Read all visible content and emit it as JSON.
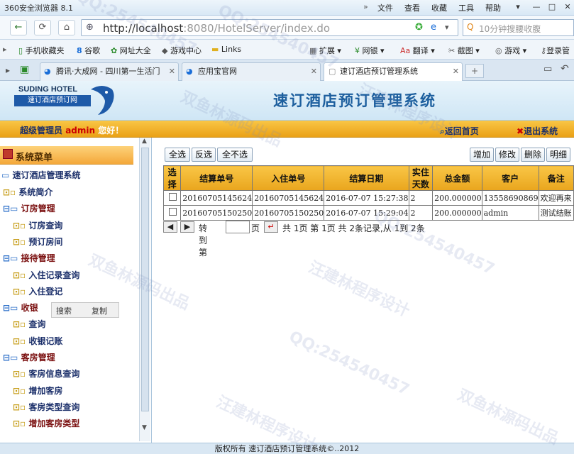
{
  "browser": {
    "title": "360安全浏览器 8.1",
    "menus": [
      "文件",
      "查看",
      "收藏",
      "工具",
      "帮助"
    ],
    "window_buttons": [
      "▾",
      "—",
      "□",
      "✕"
    ],
    "url_host": "http://localhost",
    "url_rest": ":8080/HotelServer/index.do",
    "search_placeholder": "10分钟搜腰收腹",
    "bookmarks": [
      "手机收藏夹",
      "谷歌",
      "网址大全",
      "游戏中心",
      "Links"
    ],
    "bookmarks_right": [
      "扩展",
      "网银",
      "翻译",
      "截图",
      "游戏",
      "登录管"
    ],
    "tabs": [
      {
        "label": "腾讯·大成网 - 四川第一生活门"
      },
      {
        "label": "应用宝官网"
      },
      {
        "label": "速订酒店预订管理系统"
      }
    ]
  },
  "header": {
    "logo_en": "SUDING HOTEL",
    "logo_cn": "速订酒店预订网",
    "title": "速订酒店预订管理系统",
    "admin_role": "超级管理员",
    "admin_user": "admin",
    "admin_greet": "您好！",
    "home_link": "返回首页",
    "exit_link": "退出系统"
  },
  "sidebar": {
    "heading": "系统菜单",
    "root": "速订酒店管理系统",
    "items": [
      {
        "label": "系统简介",
        "level": 1,
        "kind": "item"
      },
      {
        "label": "订房管理",
        "level": 1,
        "kind": "grp"
      },
      {
        "label": "订房查询",
        "level": 2,
        "kind": "item"
      },
      {
        "label": "预订房间",
        "level": 2,
        "kind": "item"
      },
      {
        "label": "接待管理",
        "level": 1,
        "kind": "grp"
      },
      {
        "label": "入住记录查询",
        "level": 2,
        "kind": "item"
      },
      {
        "label": "入住登记",
        "level": 2,
        "kind": "item"
      },
      {
        "label": "收银",
        "level": 1,
        "kind": "grp"
      },
      {
        "label": "查询",
        "level": 2,
        "kind": "item"
      },
      {
        "label": "收银记账",
        "level": 2,
        "kind": "item"
      },
      {
        "label": "客房管理",
        "level": 1,
        "kind": "grp"
      },
      {
        "label": "客房信息查询",
        "level": 2,
        "kind": "item"
      },
      {
        "label": "增加客房",
        "level": 2,
        "kind": "item"
      },
      {
        "label": "客房类型查询",
        "level": 2,
        "kind": "item"
      },
      {
        "label": "增加客房类型",
        "level": 2,
        "kind": "last"
      }
    ],
    "popup": {
      "search": "搜索",
      "copy": "复制"
    }
  },
  "toolbar": {
    "select_all": "全选",
    "invert": "反选",
    "select_none": "全不选",
    "add": "增加",
    "edit": "修改",
    "delete": "删除",
    "detail": "明细"
  },
  "grid": {
    "columns": [
      "选择",
      "结算单号",
      "入住单号",
      "结算日期",
      "实住天数",
      "总金额",
      "客户",
      "备注"
    ],
    "rows": [
      [
        "20160705145624",
        "20160705145624",
        "2016-07-07 15:27:38",
        "2",
        "200.000000",
        "13558690869",
        "欢迎再来"
      ],
      [
        "20160705150250",
        "20160705150250",
        "2016-07-07 15:29:04",
        "2",
        "200.000000",
        "admin",
        "测试结账"
      ]
    ]
  },
  "pager": {
    "prev": "◀",
    "next": "▶",
    "goto": "转到第",
    "page_unit": "页",
    "go": "↵",
    "summary": "共 1页 第 1页 共 2条记录,从 1到 2条"
  },
  "footer": {
    "text": "版权所有 速订酒店预订管理系统©..2012"
  },
  "watermarks": [
    "双鱼林源码出品",
    "汪建林程序设计",
    "QQ:254540457"
  ]
}
